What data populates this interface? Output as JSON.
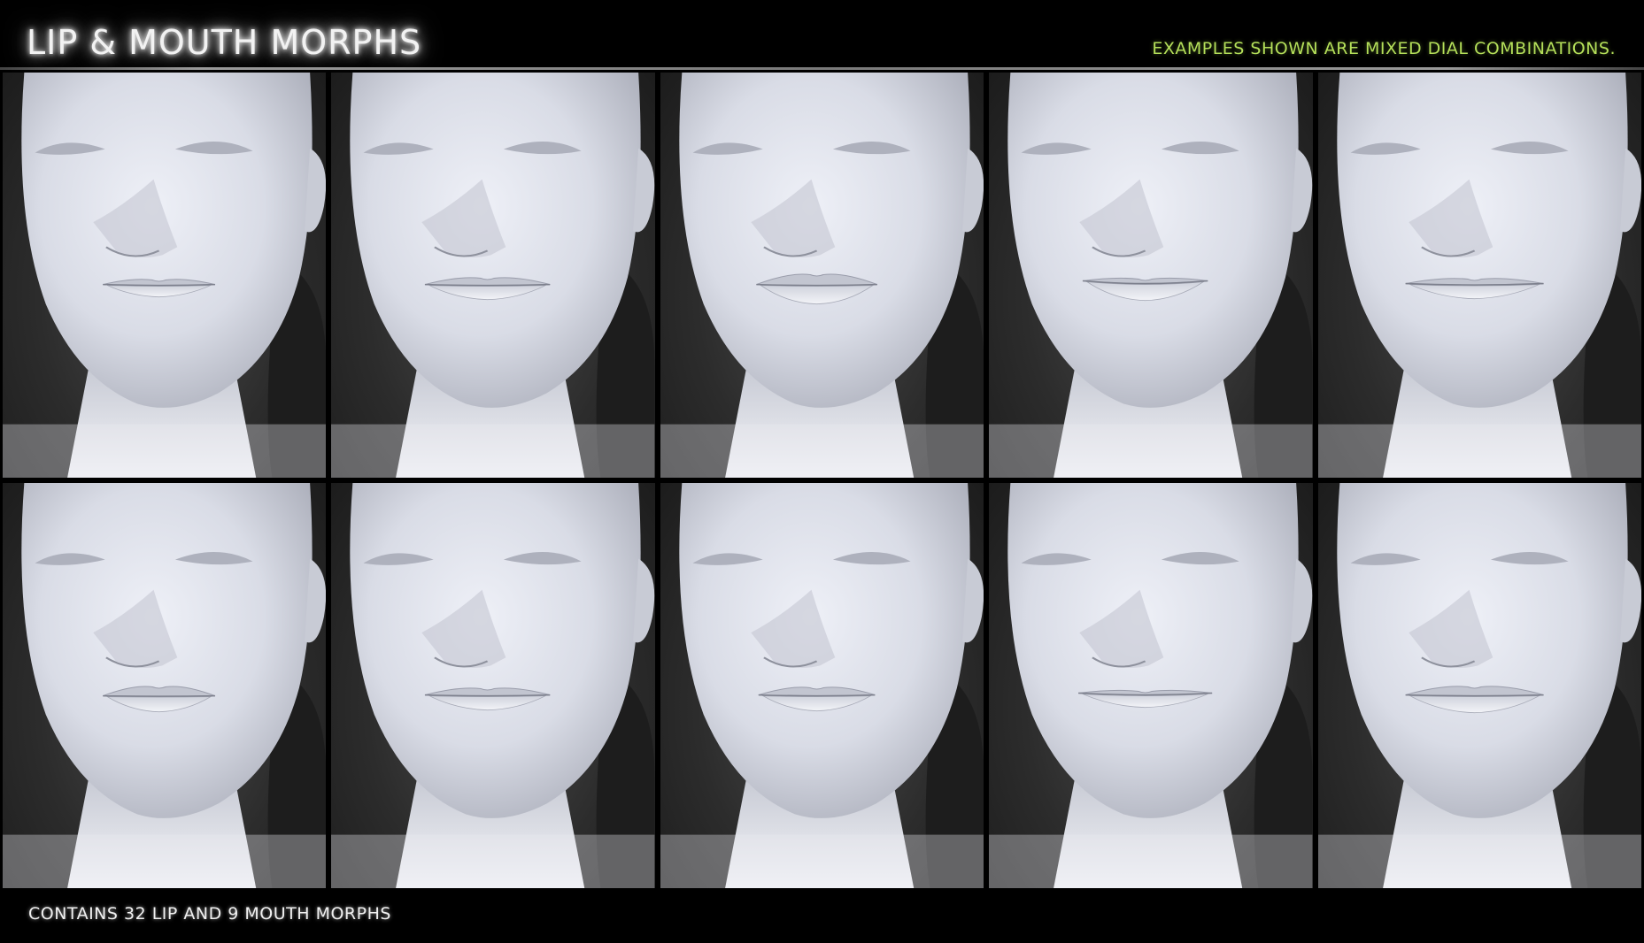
{
  "header": {
    "title": "Lip & Mouth Morphs",
    "note": "EXAMPLES SHOWN ARE MIXED DIAL COMBINATIONS."
  },
  "footer": {
    "caption": "CONTAINS 32 LIP AND 9 MOUTH MORPHS"
  },
  "panels": [
    {
      "row": 1,
      "col": 1,
      "lip_variant": "thin"
    },
    {
      "row": 1,
      "col": 2,
      "lip_variant": "medium"
    },
    {
      "row": 1,
      "col": 3,
      "lip_variant": "full"
    },
    {
      "row": 1,
      "col": 4,
      "lip_variant": "smile"
    },
    {
      "row": 1,
      "col": 5,
      "lip_variant": "wide"
    },
    {
      "row": 2,
      "col": 1,
      "lip_variant": "pouty"
    },
    {
      "row": 2,
      "col": 2,
      "lip_variant": "medium"
    },
    {
      "row": 2,
      "col": 3,
      "lip_variant": "bow"
    },
    {
      "row": 2,
      "col": 4,
      "lip_variant": "thin-wide"
    },
    {
      "row": 2,
      "col": 5,
      "lip_variant": "full-wide"
    }
  ],
  "colors": {
    "note_green": "#b5e05a",
    "skin": "#dfe1ea",
    "background": "#000000"
  }
}
